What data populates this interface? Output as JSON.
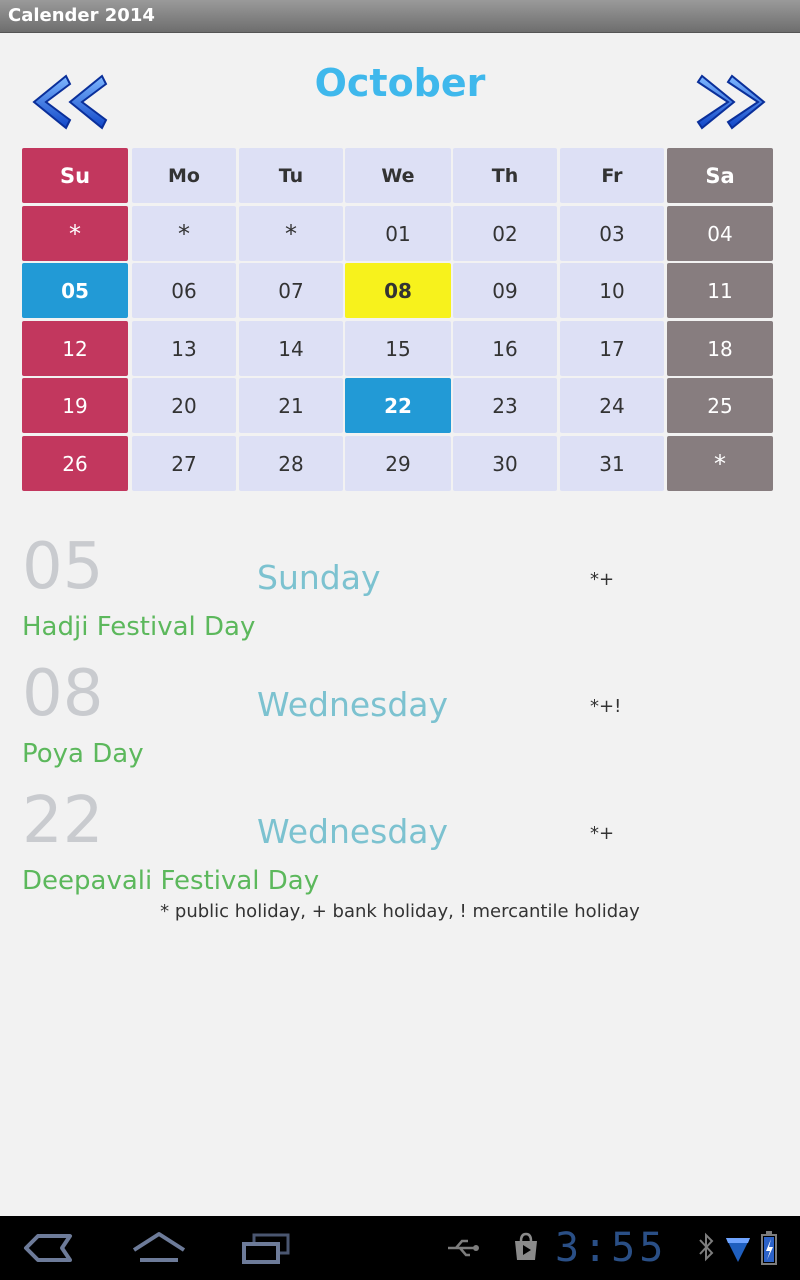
{
  "app": {
    "title": "Calender 2014"
  },
  "calendar": {
    "month": "October",
    "weekdays": [
      "Su",
      "Mo",
      "Tu",
      "We",
      "Th",
      "Fr",
      "Sa"
    ],
    "weeks": [
      [
        "*",
        "*",
        "*",
        "01",
        "02",
        "03",
        "04"
      ],
      [
        "05",
        "06",
        "07",
        "08",
        "09",
        "10",
        "11"
      ],
      [
        "12",
        "13",
        "14",
        "15",
        "16",
        "17",
        "18"
      ],
      [
        "19",
        "20",
        "21",
        "22",
        "23",
        "24",
        "25"
      ],
      [
        "26",
        "27",
        "28",
        "29",
        "30",
        "31",
        "*"
      ]
    ],
    "holiday_dates": [
      "05",
      "22"
    ],
    "today": "08",
    "colors": {
      "sunday": "#c2375e",
      "saturday": "#877d7f",
      "weekday": "#dde0f5",
      "holiday": "#229ad6",
      "today": "#f7f21c",
      "month_title": "#3fb8ec"
    }
  },
  "events": [
    {
      "day": "05",
      "weekday": "Sunday",
      "flags": "*+",
      "name": "Hadji Festival Day"
    },
    {
      "day": "08",
      "weekday": "Wednesday",
      "flags": "*+!",
      "name": "Poya Day"
    },
    {
      "day": "22",
      "weekday": "Wednesday",
      "flags": "*+",
      "name": "Deepavali Festival Day"
    }
  ],
  "legend": "* public holiday, + bank holiday, ! mercantile holiday",
  "system_bar": {
    "clock": "3:55",
    "icons": [
      "back-icon",
      "home-icon",
      "recent-apps-icon",
      "usb-icon",
      "play-store-icon",
      "bluetooth-icon",
      "wifi-icon",
      "battery-charging-icon"
    ]
  }
}
